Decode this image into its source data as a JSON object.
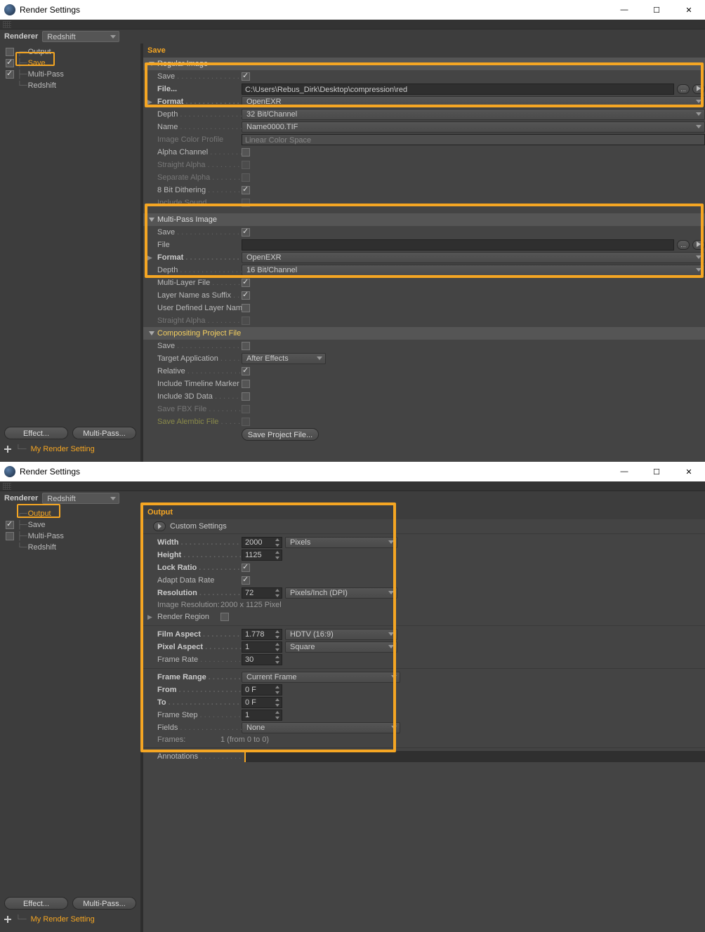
{
  "win1": {
    "title": "Render Settings",
    "renderer_label": "Renderer",
    "renderer_value": "Redshift",
    "tree": {
      "output": "Output",
      "save": "Save",
      "multipass": "Multi-Pass",
      "redshift": "Redshift"
    },
    "effect_btn": "Effect...",
    "multipass_btn": "Multi-Pass...",
    "preset": "My Render Setting",
    "main_title": "Save",
    "s1": {
      "title": "Regular Image",
      "save_lbl": "Save",
      "file_lbl": "File...",
      "file_val": "C:\\Users\\Rebus_Dirk\\Desktop\\compression\\red",
      "format_lbl": "Format",
      "format_val": "OpenEXR",
      "depth_lbl": "Depth",
      "depth_val": "32 Bit/Channel",
      "name_lbl": "Name",
      "name_val": "Name0000.TIF",
      "icp_lbl": "Image Color Profile",
      "icp_val": "Linear Color Space",
      "alpha_lbl": "Alpha Channel",
      "straight_lbl": "Straight Alpha",
      "sep_lbl": "Separate Alpha",
      "dither_lbl": "8 Bit Dithering",
      "sound_lbl": "Include Sound"
    },
    "s2": {
      "title": "Multi-Pass Image",
      "save_lbl": "Save",
      "file_lbl": "File",
      "format_lbl": "Format",
      "format_val": "OpenEXR",
      "depth_lbl": "Depth",
      "depth_val": "16 Bit/Channel",
      "mlf_lbl": "Multi-Layer File",
      "lns_lbl": "Layer Name as Suffix",
      "udn_lbl": "User Defined Layer Name",
      "straight_lbl": "Straight Alpha"
    },
    "s3": {
      "title": "Compositing Project File",
      "save_lbl": "Save",
      "target_lbl": "Target Application",
      "target_val": "After Effects",
      "rel_lbl": "Relative",
      "tm_lbl": "Include Timeline Marker",
      "d3_lbl": "Include 3D Data",
      "fbx_lbl": "Save FBX File",
      "abc_lbl": "Save Alembic File",
      "btn": "Save Project File..."
    }
  },
  "win2": {
    "title": "Render Settings",
    "renderer_label": "Renderer",
    "renderer_value": "Redshift",
    "tree": {
      "output": "Output",
      "save": "Save",
      "multipass": "Multi-Pass",
      "redshift": "Redshift"
    },
    "effect_btn": "Effect...",
    "multipass_btn": "Multi-Pass...",
    "preset": "My Render Setting",
    "main_title": "Output",
    "custom": "Custom Settings",
    "g1": {
      "width_lbl": "Width",
      "width_val": "2000",
      "width_unit": "Pixels",
      "height_lbl": "Height",
      "height_val": "1125",
      "lock_lbl": "Lock Ratio",
      "adapt_lbl": "Adapt Data Rate",
      "res_lbl": "Resolution",
      "res_val": "72",
      "res_unit": "Pixels/Inch (DPI)",
      "imgres_lbl": "Image Resolution:",
      "imgres_val": "2000 x 1125 Pixel",
      "region_lbl": "Render Region"
    },
    "g2": {
      "fa_lbl": "Film Aspect",
      "fa_val": "1.778",
      "fa_opt": "HDTV (16:9)",
      "pa_lbl": "Pixel Aspect",
      "pa_val": "1",
      "pa_opt": "Square",
      "fr_lbl": "Frame Rate",
      "fr_val": "30"
    },
    "g3": {
      "range_lbl": "Frame Range",
      "range_val": "Current Frame",
      "from_lbl": "From",
      "from_val": "0 F",
      "to_lbl": "To",
      "to_val": "0 F",
      "step_lbl": "Frame Step",
      "step_val": "1",
      "fields_lbl": "Fields",
      "fields_val": "None",
      "frames_lbl": "Frames:",
      "frames_val": "1 (from 0 to 0)"
    },
    "annot_lbl": "Annotations"
  }
}
